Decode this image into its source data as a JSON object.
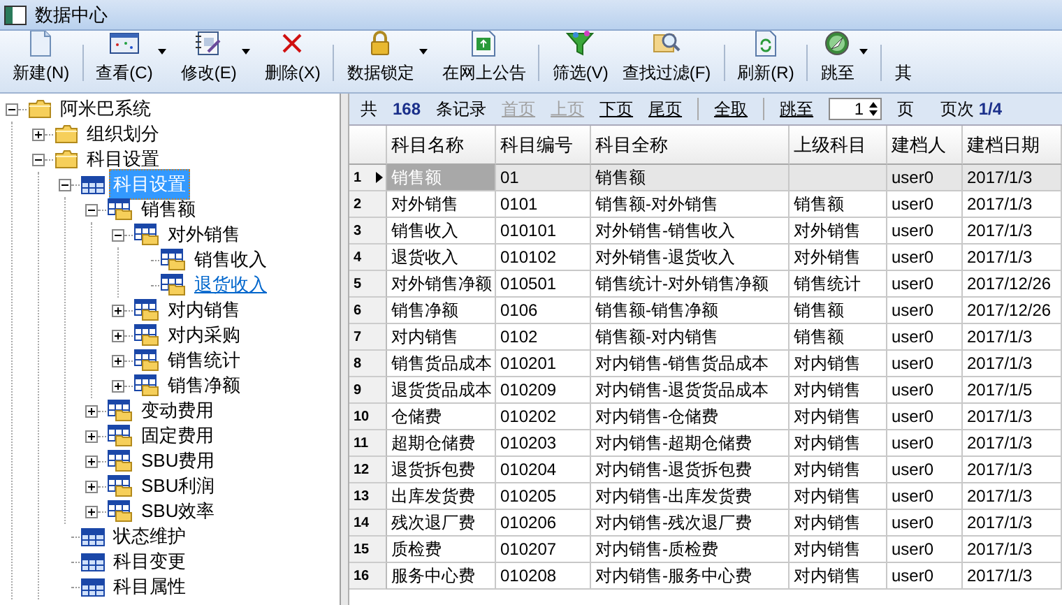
{
  "window": {
    "title": "数据中心"
  },
  "toolbar": [
    {
      "kind": "button",
      "label": "新建(N)",
      "dropdown": false
    },
    {
      "kind": "separator"
    },
    {
      "kind": "button",
      "label": "查看(C)",
      "dropdown": true
    },
    {
      "kind": "button",
      "label": "修改(E)",
      "dropdown": true
    },
    {
      "kind": "button",
      "label": "删除(X)",
      "dropdown": false
    },
    {
      "kind": "separator"
    },
    {
      "kind": "button",
      "label": "数据锁定",
      "dropdown": true
    },
    {
      "kind": "button",
      "label": "在网上公告",
      "dropdown": false
    },
    {
      "kind": "separator"
    },
    {
      "kind": "button",
      "label": "筛选(V)",
      "dropdown": false
    },
    {
      "kind": "button",
      "label": "查找过滤(F)",
      "dropdown": false
    },
    {
      "kind": "separator"
    },
    {
      "kind": "button",
      "label": "刷新(R)",
      "dropdown": false
    },
    {
      "kind": "separator"
    },
    {
      "kind": "button",
      "label": "跳至",
      "dropdown": true
    },
    {
      "kind": "separator"
    },
    {
      "kind": "button",
      "label": "其",
      "dropdown": false
    }
  ],
  "tree": [
    {
      "label": "阿米巴系统",
      "kind": "folder",
      "expanded": true,
      "selected": false,
      "hovered": false,
      "children": [
        {
          "label": "组织划分",
          "kind": "folder",
          "expanded": false,
          "selected": false,
          "hovered": false
        },
        {
          "label": "科目设置",
          "kind": "folder",
          "expanded": true,
          "selected": false,
          "hovered": false,
          "children": [
            {
              "label": "科目设置",
              "kind": "grid",
              "expanded": true,
              "selected": true,
              "hovered": false,
              "children": [
                {
                  "label": "销售额",
                  "kind": "gridfolder",
                  "expanded": true,
                  "selected": false,
                  "hovered": false,
                  "children": [
                    {
                      "label": "对外销售",
                      "kind": "gridfolder",
                      "expanded": true,
                      "selected": false,
                      "hovered": false,
                      "children": [
                        {
                          "label": "销售收入",
                          "kind": "gridfolder",
                          "selected": false,
                          "hovered": false
                        },
                        {
                          "label": "退货收入",
                          "kind": "gridfolder",
                          "selected": false,
                          "hovered": true
                        }
                      ]
                    },
                    {
                      "label": "对内销售",
                      "kind": "gridfolder",
                      "expanded": false,
                      "selected": false,
                      "hovered": false
                    },
                    {
                      "label": "对内采购",
                      "kind": "gridfolder",
                      "expanded": false,
                      "selected": false,
                      "hovered": false
                    },
                    {
                      "label": "销售统计",
                      "kind": "gridfolder",
                      "expanded": false,
                      "selected": false,
                      "hovered": false
                    },
                    {
                      "label": "销售净额",
                      "kind": "gridfolder",
                      "expanded": false,
                      "selected": false,
                      "hovered": false
                    }
                  ]
                },
                {
                  "label": "变动费用",
                  "kind": "gridfolder",
                  "expanded": false,
                  "selected": false,
                  "hovered": false
                },
                {
                  "label": "固定费用",
                  "kind": "gridfolder",
                  "expanded": false,
                  "selected": false,
                  "hovered": false
                },
                {
                  "label": "SBU费用",
                  "kind": "gridfolder",
                  "expanded": false,
                  "selected": false,
                  "hovered": false
                },
                {
                  "label": "SBU利润",
                  "kind": "gridfolder",
                  "expanded": false,
                  "selected": false,
                  "hovered": false
                },
                {
                  "label": "SBU效率",
                  "kind": "gridfolder",
                  "expanded": false,
                  "selected": false,
                  "hovered": false
                }
              ]
            },
            {
              "label": "状态维护",
              "kind": "grid",
              "selected": false,
              "hovered": false
            },
            {
              "label": "科目变更",
              "kind": "grid",
              "selected": false,
              "hovered": false
            },
            {
              "label": "科目属性",
              "kind": "grid",
              "selected": false,
              "hovered": false
            }
          ]
        }
      ]
    }
  ],
  "pager": {
    "total_prefix": "共",
    "total": "168",
    "total_suffix": "条记录",
    "nav": [
      {
        "label": "首页",
        "disabled": true
      },
      {
        "label": "上页",
        "disabled": true
      },
      {
        "label": "下页",
        "disabled": false
      },
      {
        "label": "尾页",
        "disabled": false
      }
    ],
    "select_all": "全取",
    "jump": "跳至",
    "page_value": "1",
    "page_unit": "页",
    "page_label": "页次",
    "page_indicator": "1/4"
  },
  "table": {
    "columns": [
      "科目名称",
      "科目编号",
      "科目全称",
      "上级科目",
      "建档人",
      "建档日期"
    ],
    "rows": [
      {
        "no": "1",
        "selected": true,
        "cells": [
          "销售额",
          "01",
          "销售额",
          "",
          "user0",
          "2017/1/3"
        ]
      },
      {
        "no": "2",
        "selected": false,
        "cells": [
          "对外销售",
          "0101",
          "销售额-对外销售",
          "销售额",
          "user0",
          "2017/1/3"
        ]
      },
      {
        "no": "3",
        "selected": false,
        "cells": [
          "销售收入",
          "010101",
          "对外销售-销售收入",
          "对外销售",
          "user0",
          "2017/1/3"
        ]
      },
      {
        "no": "4",
        "selected": false,
        "cells": [
          "退货收入",
          "010102",
          "对外销售-退货收入",
          "对外销售",
          "user0",
          "2017/1/3"
        ]
      },
      {
        "no": "5",
        "selected": false,
        "cells": [
          "对外销售净额",
          "010501",
          "销售统计-对外销售净额",
          "销售统计",
          "user0",
          "2017/12/26"
        ]
      },
      {
        "no": "6",
        "selected": false,
        "cells": [
          "销售净额",
          "0106",
          "销售额-销售净额",
          "销售额",
          "user0",
          "2017/12/26"
        ]
      },
      {
        "no": "7",
        "selected": false,
        "cells": [
          "对内销售",
          "0102",
          "销售额-对内销售",
          "销售额",
          "user0",
          "2017/1/3"
        ]
      },
      {
        "no": "8",
        "selected": false,
        "cells": [
          "销售货品成本",
          "010201",
          "对内销售-销售货品成本",
          "对内销售",
          "user0",
          "2017/1/3"
        ]
      },
      {
        "no": "9",
        "selected": false,
        "cells": [
          "退货货品成本",
          "010209",
          "对内销售-退货货品成本",
          "对内销售",
          "user0",
          "2017/1/5"
        ]
      },
      {
        "no": "10",
        "selected": false,
        "cells": [
          "仓储费",
          "010202",
          "对内销售-仓储费",
          "对内销售",
          "user0",
          "2017/1/3"
        ]
      },
      {
        "no": "11",
        "selected": false,
        "cells": [
          "超期仓储费",
          "010203",
          "对内销售-超期仓储费",
          "对内销售",
          "user0",
          "2017/1/3"
        ]
      },
      {
        "no": "12",
        "selected": false,
        "cells": [
          "退货拆包费",
          "010204",
          "对内销售-退货拆包费",
          "对内销售",
          "user0",
          "2017/1/3"
        ]
      },
      {
        "no": "13",
        "selected": false,
        "cells": [
          "出库发货费",
          "010205",
          "对内销售-出库发货费",
          "对内销售",
          "user0",
          "2017/1/3"
        ]
      },
      {
        "no": "14",
        "selected": false,
        "cells": [
          "残次退厂费",
          "010206",
          "对内销售-残次退厂费",
          "对内销售",
          "user0",
          "2017/1/3"
        ]
      },
      {
        "no": "15",
        "selected": false,
        "cells": [
          "质检费",
          "010207",
          "对内销售-质检费",
          "对内销售",
          "user0",
          "2017/1/3"
        ]
      },
      {
        "no": "16",
        "selected": false,
        "cells": [
          "服务中心费",
          "010208",
          "对内销售-服务中心费",
          "对内销售",
          "user0",
          "2017/1/3"
        ]
      }
    ]
  }
}
